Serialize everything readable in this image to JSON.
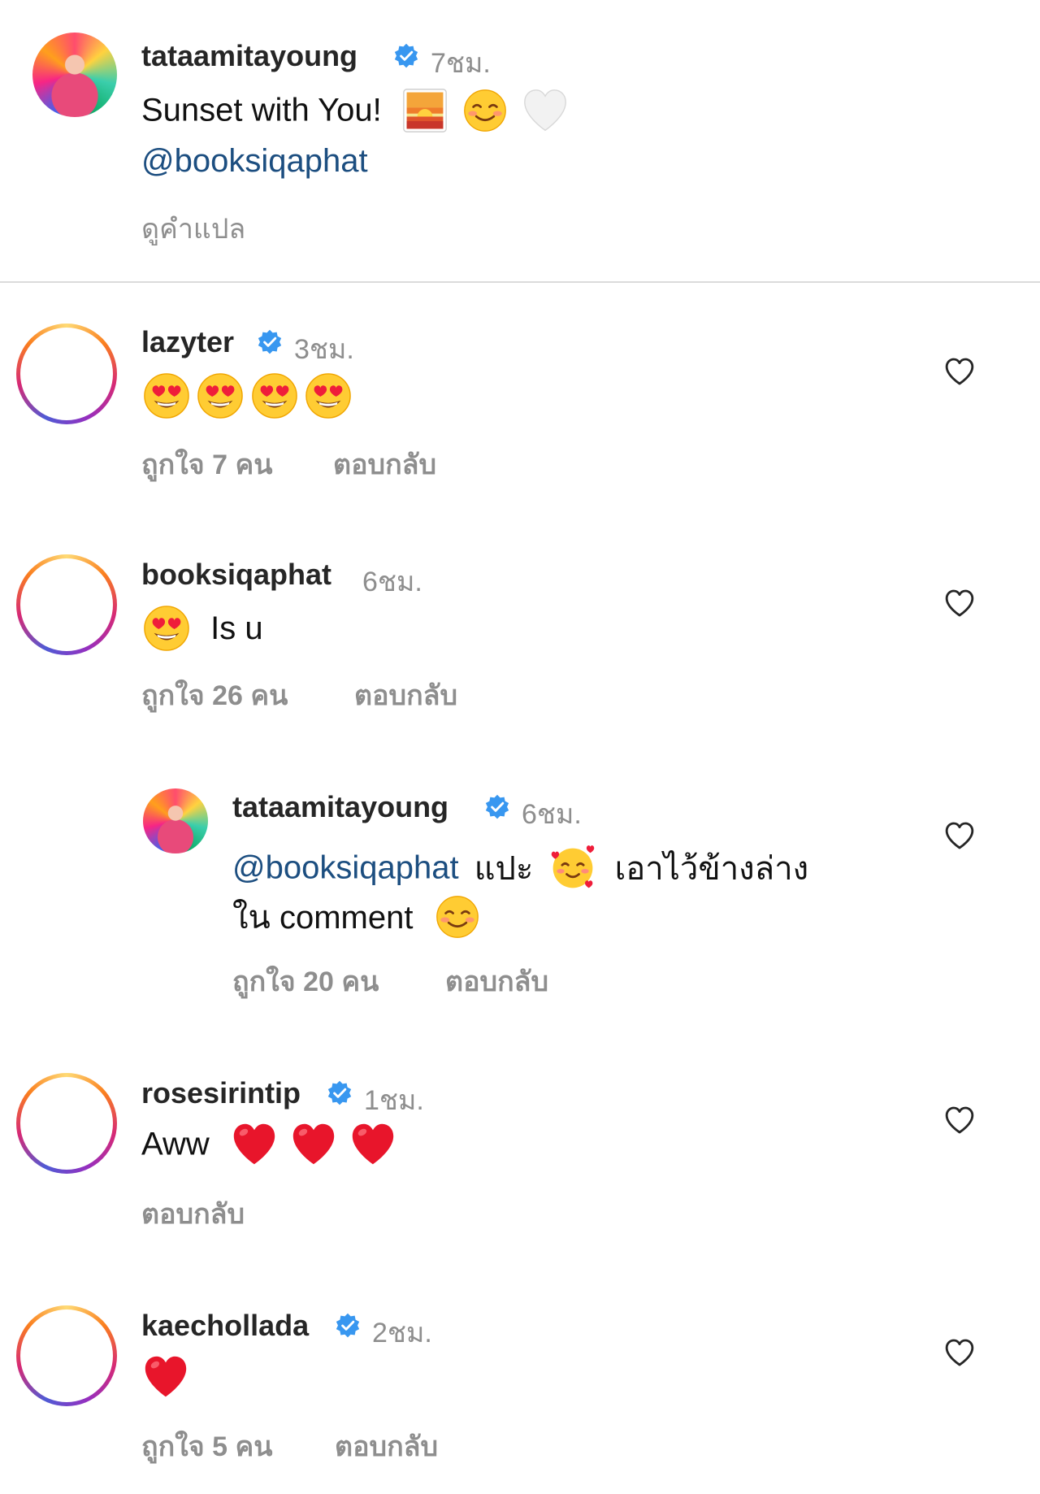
{
  "caption": {
    "username": "tataamitayoung",
    "time": "7ชม.",
    "text": "Sunset with You!",
    "emojis": [
      "sunset-emoji",
      "smiling-face-emoji",
      "white-heart-emoji"
    ],
    "mention": "@booksiqaphat",
    "see_translation": "ดูคำแปล"
  },
  "comments": [
    {
      "username": "lazyter",
      "verified": true,
      "time": "3ชม.",
      "emojis": [
        "heart-eyes-emoji",
        "heart-eyes-emoji",
        "heart-eyes-emoji",
        "heart-eyes-emoji"
      ],
      "likes": "ถูกใจ 7 คน",
      "reply": "ตอบกลับ"
    },
    {
      "username": "booksiqaphat",
      "verified": false,
      "time": "6ชม.",
      "text": "Is u",
      "emojis": [
        "heart-eyes-emoji"
      ],
      "likes": "ถูกใจ 26 คน",
      "reply": "ตอบกลับ"
    },
    {
      "username": "tataamitayoung",
      "verified": true,
      "time": "6ชม.",
      "is_reply": true,
      "mention": "@booksiqaphat",
      "text_part1": "แปะ",
      "text_part2": "เอาไว้ข้างล่าง",
      "text_line2": "ใน comment",
      "emojis": [
        "smiling-face-with-hearts-emoji",
        "smiling-face-emoji"
      ],
      "likes": "ถูกใจ 20 คน",
      "reply": "ตอบกลับ"
    },
    {
      "username": "rosesirintip",
      "verified": true,
      "time": "1ชม.",
      "text": "Aww",
      "emojis": [
        "red-heart-emoji",
        "red-heart-emoji",
        "red-heart-emoji"
      ],
      "reply": "ตอบกลับ"
    },
    {
      "username": "kaechollada",
      "verified": true,
      "time": "2ชม.",
      "emojis": [
        "red-heart-emoji"
      ],
      "likes": "ถูกใจ 5 คน",
      "reply": "ตอบกลับ"
    }
  ],
  "colors": {
    "verified_blue": "#3897f0",
    "mention_blue": "#1c4e80",
    "meta_gray": "#8e8e8e",
    "divider": "#dbdbdb"
  }
}
